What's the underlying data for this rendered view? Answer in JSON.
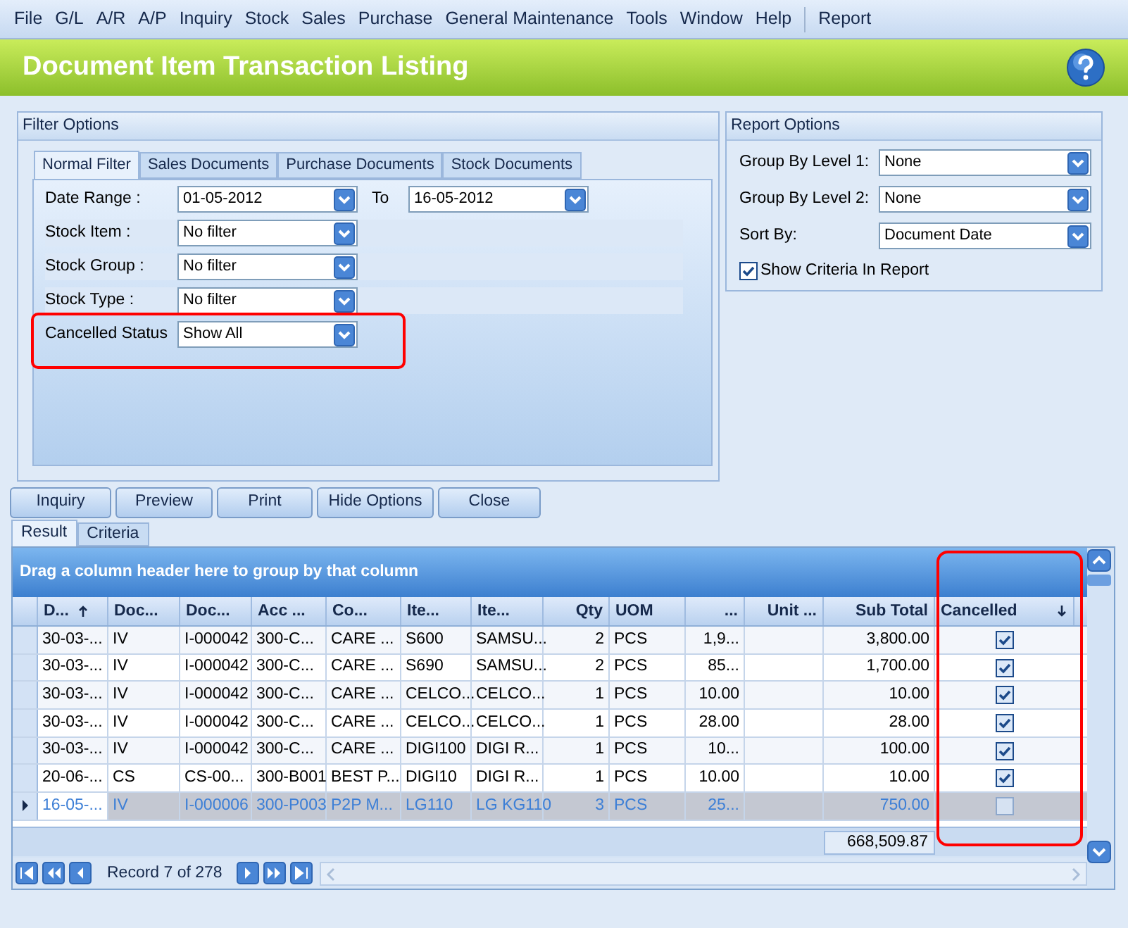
{
  "menu": [
    {
      "label": "File"
    },
    {
      "label": "G/L"
    },
    {
      "label": "A/R"
    },
    {
      "label": "A/P"
    },
    {
      "label": "Inquiry"
    },
    {
      "label": "Stock"
    },
    {
      "label": "Sales"
    },
    {
      "label": "Purchase"
    },
    {
      "label": "General Maintenance"
    },
    {
      "label": "Tools"
    },
    {
      "label": "Window"
    },
    {
      "label": "Help"
    },
    {
      "label": "Report"
    }
  ],
  "header": {
    "title": "Document Item Transaction Listing"
  },
  "filter_options": {
    "title": "Filter Options",
    "tabs": [
      {
        "label": "Normal Filter",
        "selected": true
      },
      {
        "label": "Sales Documents",
        "selected": false
      },
      {
        "label": "Purchase Documents",
        "selected": false
      },
      {
        "label": "Stock Documents",
        "selected": false
      }
    ],
    "date_range": {
      "label": "Date Range :",
      "from": "01-05-2012",
      "to_label": "To",
      "to": "16-05-2012"
    },
    "fields": [
      {
        "label": "Stock Item :",
        "value": "No filter"
      },
      {
        "label": "Stock Group :",
        "value": "No filter"
      },
      {
        "label": "Stock Type :",
        "value": "No filter"
      },
      {
        "label": "Cancelled Status",
        "value": "Show All",
        "highlighted": true
      }
    ]
  },
  "report_options": {
    "title": "Report Options",
    "fields": [
      {
        "label": "Group By Level 1:",
        "value": "None"
      },
      {
        "label": "Group By Level 2:",
        "value": "None"
      },
      {
        "label": "Sort By:",
        "value": "Document Date"
      }
    ],
    "show_criteria": {
      "label": "Show Criteria In Report",
      "checked": true
    }
  },
  "buttons": [
    "Inquiry",
    "Preview",
    "Print",
    "Hide Options",
    "Close"
  ],
  "result_tabs": [
    {
      "label": "Result",
      "selected": true
    },
    {
      "label": "Criteria",
      "selected": false
    }
  ],
  "grid": {
    "group_panel": "Drag a column header here to group by that column",
    "columns": [
      {
        "label": "D...",
        "sorted": true,
        "descending": false
      },
      {
        "label": "Doc...",
        "sorted": false
      },
      {
        "label": "Doc...",
        "sorted": false
      },
      {
        "label": "Acc ...",
        "sorted": false
      },
      {
        "label": "Co...",
        "sorted": false
      },
      {
        "label": "Ite...",
        "sorted": false
      },
      {
        "label": "Ite...",
        "sorted": false
      },
      {
        "label": "Qty",
        "sorted": false
      },
      {
        "label": "UOM",
        "sorted": false
      },
      {
        "label": "...",
        "sorted": false
      },
      {
        "label": "Unit ...",
        "sorted": false
      },
      {
        "label": "Sub Total",
        "sorted": false
      },
      {
        "label": "Cancelled",
        "sorted": true,
        "descending": true,
        "highlighted": true
      }
    ],
    "rows": [
      {
        "cells": [
          "30-03-...",
          "IV",
          "I-000042",
          "300-C...",
          "CARE ...",
          "S600",
          "SAMSU...",
          "2",
          "PCS",
          "1,9...",
          null,
          "3,800.00"
        ],
        "cancelled": true,
        "selected": false
      },
      {
        "cells": [
          "30-03-...",
          "IV",
          "I-000042",
          "300-C...",
          "CARE ...",
          "S690",
          "SAMSU...",
          "2",
          "PCS",
          "85...",
          null,
          "1,700.00"
        ],
        "cancelled": true,
        "selected": false
      },
      {
        "cells": [
          "30-03-...",
          "IV",
          "I-000042",
          "300-C...",
          "CARE ...",
          "CELCO...",
          "CELCO...",
          "1",
          "PCS",
          "10.00",
          null,
          "10.00"
        ],
        "cancelled": true,
        "selected": false
      },
      {
        "cells": [
          "30-03-...",
          "IV",
          "I-000042",
          "300-C...",
          "CARE ...",
          "CELCO...",
          "CELCO...",
          "1",
          "PCS",
          "28.00",
          null,
          "28.00"
        ],
        "cancelled": true,
        "selected": false
      },
      {
        "cells": [
          "30-03-...",
          "IV",
          "I-000042",
          "300-C...",
          "CARE ...",
          "DIGI100",
          "DIGI R...",
          "1",
          "PCS",
          "10...",
          null,
          "100.00"
        ],
        "cancelled": true,
        "selected": false
      },
      {
        "cells": [
          "20-06-...",
          "CS",
          "CS-00...",
          "300-B001",
          "BEST P...",
          "DIGI10",
          "DIGI R...",
          "1",
          "PCS",
          "10.00",
          null,
          "10.00"
        ],
        "cancelled": true,
        "selected": false
      },
      {
        "cells": [
          "16-05-...",
          "IV",
          "I-000006",
          "300-P003",
          "P2P M...",
          "LG110",
          "LG KG110",
          "3",
          "PCS",
          "25...",
          null,
          "750.00"
        ],
        "cancelled": false,
        "selected": true
      }
    ],
    "total": "668,509.87",
    "record": "Record 7 of 278"
  }
}
